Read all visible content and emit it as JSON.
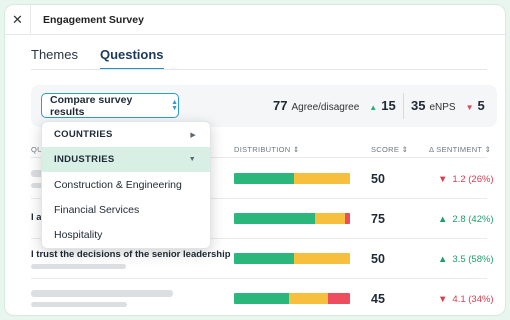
{
  "window": {
    "close_glyph": "✕",
    "title": "Engagement Survey"
  },
  "tabs": [
    {
      "label": "Themes"
    },
    {
      "label": "Questions"
    }
  ],
  "statsbar": {
    "compare_label": "Compare survey results",
    "agree_value": "77",
    "agree_label": "Agree/disagree",
    "agree_delta": "15",
    "enps_value": "35",
    "enps_label": "eNPS",
    "enps_delta": "5"
  },
  "table": {
    "headers": [
      "QU",
      "DISTRIBUTION ⇕",
      "SCORE ⇕",
      "Δ SENTIMENT ⇕"
    ],
    "rows": [
      {
        "question": "",
        "score": "50",
        "sentiment": "1.2 (26%)",
        "trend": "down",
        "distribution": [
          0.52,
          0.48,
          0.0
        ]
      },
      {
        "question": "I a",
        "score": "75",
        "sentiment": "2.8 (42%)",
        "trend": "up",
        "distribution": [
          0.7,
          0.26,
          0.04
        ]
      },
      {
        "question": "I trust the decisions of the senior leadership",
        "score": "50",
        "sentiment": "3.5 (58%)",
        "trend": "up",
        "distribution": [
          0.52,
          0.48,
          0.0
        ]
      },
      {
        "question": "",
        "score": "45",
        "sentiment": "4.1 (34%)",
        "trend": "down",
        "distribution": [
          0.47,
          0.34,
          0.19
        ]
      }
    ]
  },
  "dropdown": {
    "items": [
      {
        "label": "COUNTRIES",
        "type": "category",
        "arrow": "▶"
      },
      {
        "label": "INDUSTRIES",
        "type": "category",
        "arrow": "▼"
      },
      {
        "label": "Construction & Engineering",
        "type": "option"
      },
      {
        "label": "Financial Services",
        "type": "option"
      },
      {
        "label": "Hospitality",
        "type": "option"
      }
    ]
  },
  "colors": {
    "accent": "#2f9ad6",
    "positive": "#2bb67c",
    "neutral": "#f6bf3e",
    "negative": "#ee4c5f"
  }
}
